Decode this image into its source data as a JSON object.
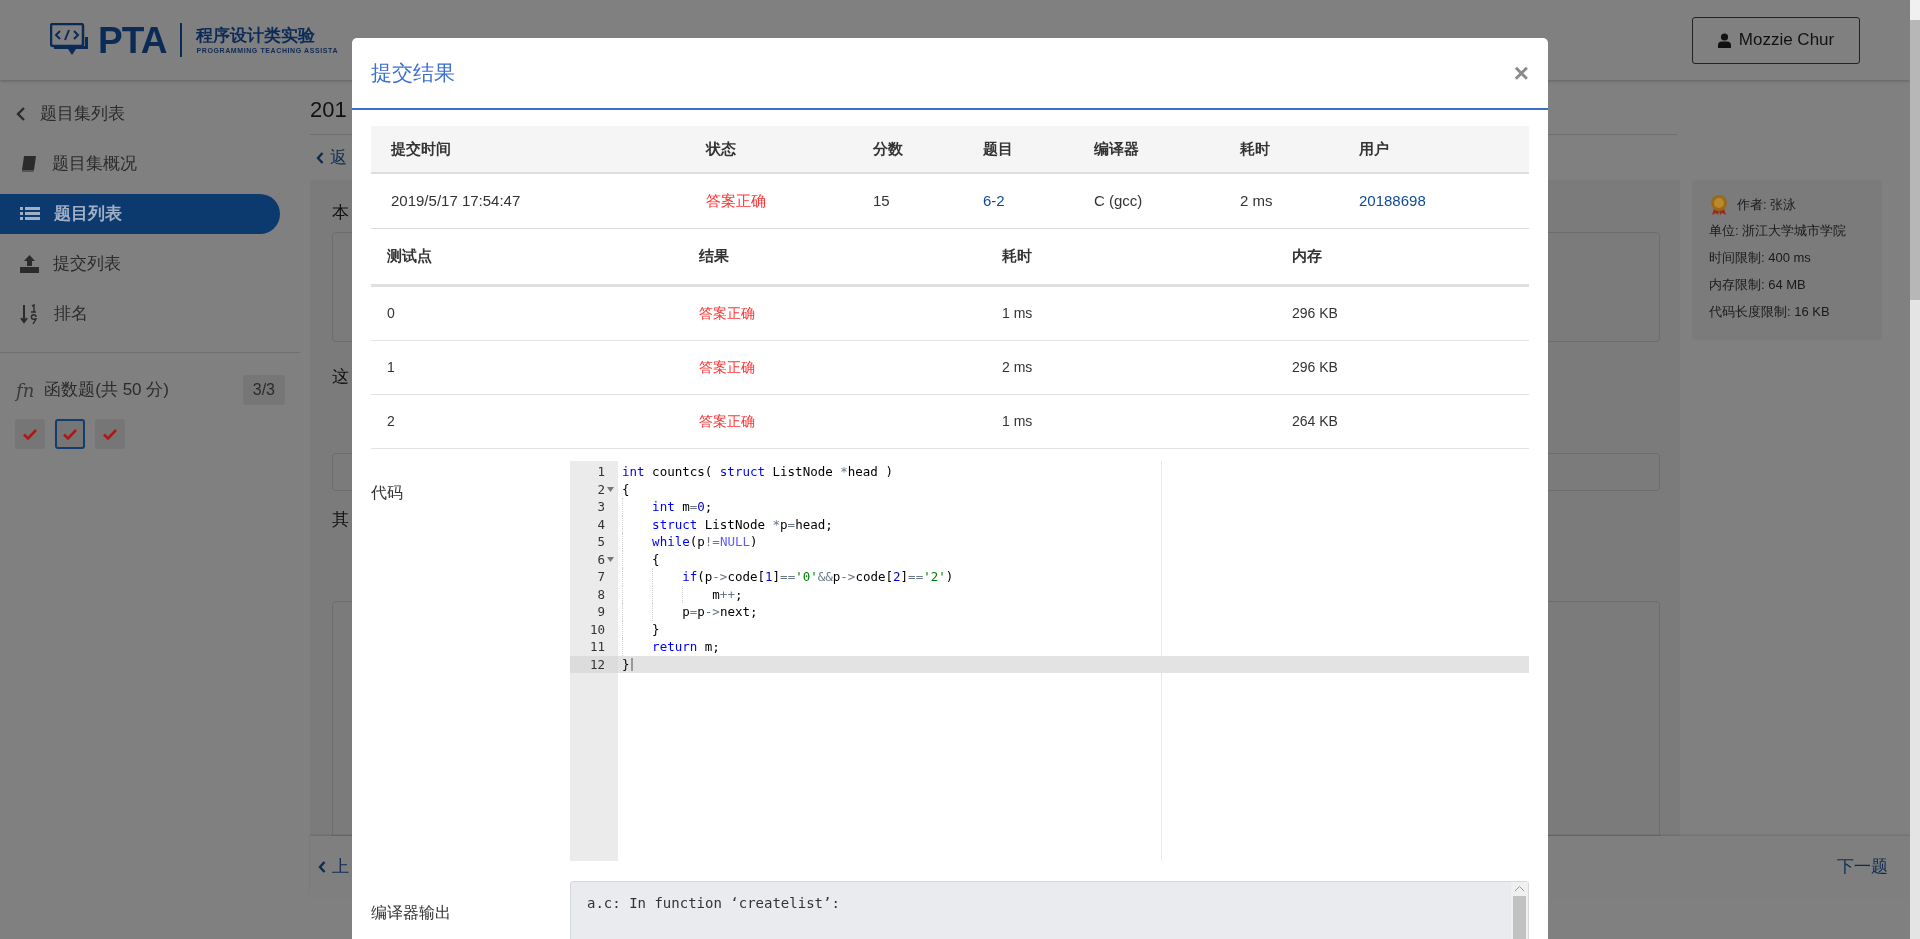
{
  "header": {
    "logo_text": "PTA",
    "platform_name": "程序设计类实验",
    "platform_subtitle": "PROGRAMMING TEACHING ASSISTA",
    "user_button": "Mozzie Chur"
  },
  "sidebar": {
    "items": [
      {
        "label": "题目集列表",
        "selected": false
      },
      {
        "label": "题目集概况",
        "selected": false
      },
      {
        "label": "题目列表",
        "selected": true
      },
      {
        "label": "提交列表",
        "selected": false
      },
      {
        "label": "排名",
        "selected": false
      }
    ],
    "section": {
      "icon_text": "fn",
      "label": "函数题(共 50 分)",
      "count": "3/3"
    },
    "problems": [
      {
        "solved": true,
        "selected": false
      },
      {
        "solved": true,
        "selected": true
      },
      {
        "solved": true,
        "selected": false
      }
    ]
  },
  "page": {
    "title": "201",
    "back_link": "返",
    "fragments": [
      "本",
      "这"
    ],
    "fragment_3": "其",
    "prev_link": "上",
    "next_link": "下一题"
  },
  "problem_info": {
    "author": "作者: 张泳",
    "lines": [
      "单位: 浙江大学城市学院",
      "时间限制: 400 ms",
      "内存限制: 64 MB",
      "代码长度限制: 16 KB"
    ]
  },
  "modal": {
    "title": "提交结果",
    "close": "×",
    "submission": {
      "columns": [
        "提交时间",
        "状态",
        "分数",
        "题目",
        "编译器",
        "耗时",
        "用户"
      ],
      "row": [
        {
          "text": "2019/5/17 17:54:47",
          "kind": "plain"
        },
        {
          "text": "答案正确",
          "kind": "status"
        },
        {
          "text": "15",
          "kind": "plain"
        },
        {
          "text": "6-2",
          "kind": "link"
        },
        {
          "text": "C (gcc)",
          "kind": "plain"
        },
        {
          "text": "2 ms",
          "kind": "plain"
        },
        {
          "text": "20188698",
          "kind": "link"
        }
      ]
    },
    "tests": {
      "columns": [
        "测试点",
        "结果",
        "耗时",
        "内存"
      ],
      "rows": [
        [
          "0",
          "答案正确",
          "1 ms",
          "296 KB"
        ],
        [
          "1",
          "答案正确",
          "2 ms",
          "296 KB"
        ],
        [
          "2",
          "答案正确",
          "1 ms",
          "264 KB"
        ]
      ]
    },
    "code_label": "代码",
    "code": [
      {
        "number": "1",
        "fold": false,
        "active": false,
        "tokens": [
          {
            "kind": "kw",
            "text": "int"
          },
          {
            "kind": "plain",
            "text": " countcs( "
          },
          {
            "kind": "kw",
            "text": "struct"
          },
          {
            "kind": "plain",
            "text": " ListNode "
          },
          {
            "kind": "op",
            "text": "*"
          },
          {
            "kind": "plain",
            "text": "head )"
          }
        ]
      },
      {
        "number": "2",
        "fold": true,
        "active": false,
        "tokens": [
          {
            "kind": "plain",
            "text": "{"
          }
        ],
        "children": [
          {
            "number": "3",
            "fold": false,
            "active": false,
            "tokens": [
              {
                "kind": "kw",
                "text": "int"
              },
              {
                "kind": "plain",
                "text": " m"
              },
              {
                "kind": "op",
                "text": "="
              },
              {
                "kind": "num",
                "text": "0"
              },
              {
                "kind": "plain",
                "text": ";"
              }
            ]
          },
          {
            "number": "4",
            "fold": false,
            "active": false,
            "tokens": [
              {
                "kind": "kw",
                "text": "struct"
              },
              {
                "kind": "plain",
                "text": " ListNode "
              },
              {
                "kind": "op",
                "text": "*"
              },
              {
                "kind": "plain",
                "text": "p"
              },
              {
                "kind": "op",
                "text": "="
              },
              {
                "kind": "plain",
                "text": "head;"
              }
            ]
          },
          {
            "number": "5",
            "fold": false,
            "active": false,
            "tokens": [
              {
                "kind": "kw",
                "text": "while"
              },
              {
                "kind": "plain",
                "text": "(p"
              },
              {
                "kind": "op",
                "text": "!="
              },
              {
                "kind": "const",
                "text": "NULL"
              },
              {
                "kind": "plain",
                "text": ")"
              }
            ]
          },
          {
            "number": "6",
            "fold": true,
            "active": false,
            "tokens": [
              {
                "kind": "plain",
                "text": "{"
              }
            ],
            "children": [
              {
                "number": "7",
                "fold": false,
                "active": false,
                "tokens": [
                  {
                    "kind": "kw",
                    "text": "if"
                  },
                  {
                    "kind": "plain",
                    "text": "(p"
                  },
                  {
                    "kind": "op",
                    "text": "->"
                  },
                  {
                    "kind": "plain",
                    "text": "code["
                  },
                  {
                    "kind": "num",
                    "text": "1"
                  },
                  {
                    "kind": "plain",
                    "text": "]"
                  },
                  {
                    "kind": "op",
                    "text": "=="
                  },
                  {
                    "kind": "str",
                    "text": "'0'"
                  },
                  {
                    "kind": "op",
                    "text": "&&"
                  },
                  {
                    "kind": "plain",
                    "text": "p"
                  },
                  {
                    "kind": "op",
                    "text": "->"
                  },
                  {
                    "kind": "plain",
                    "text": "code["
                  },
                  {
                    "kind": "num",
                    "text": "2"
                  },
                  {
                    "kind": "plain",
                    "text": "]"
                  },
                  {
                    "kind": "op",
                    "text": "=="
                  },
                  {
                    "kind": "str",
                    "text": "'2'"
                  },
                  {
                    "kind": "plain",
                    "text": ")"
                  }
                ],
                "children": [
                  {
                    "number": "8",
                    "fold": false,
                    "active": false,
                    "tokens": [
                      {
                        "kind": "plain",
                        "text": "m"
                      },
                      {
                        "kind": "op",
                        "text": "++"
                      },
                      {
                        "kind": "plain",
                        "text": ";"
                      }
                    ]
                  }
                ]
              },
              {
                "number": "9",
                "fold": false,
                "active": false,
                "tokens": [
                  {
                    "kind": "plain",
                    "text": "p"
                  },
                  {
                    "kind": "op",
                    "text": "="
                  },
                  {
                    "kind": "plain",
                    "text": "p"
                  },
                  {
                    "kind": "op",
                    "text": "->"
                  },
                  {
                    "kind": "plain",
                    "text": "next;"
                  }
                ]
              }
            ]
          },
          {
            "number": "10",
            "fold": false,
            "active": false,
            "tokens": [
              {
                "kind": "plain",
                "text": "}"
              }
            ]
          },
          {
            "number": "11",
            "fold": false,
            "active": false,
            "tokens": [
              {
                "kind": "kw",
                "text": "return"
              },
              {
                "kind": "plain",
                "text": " m;"
              }
            ]
          }
        ]
      },
      {
        "number": "12",
        "fold": false,
        "active": true,
        "tokens": [
          {
            "kind": "plain",
            "text": "}"
          }
        ]
      }
    ],
    "compiler_label": "编译器输出",
    "compiler_output": "a.c: In function ‘createlist’:"
  }
}
